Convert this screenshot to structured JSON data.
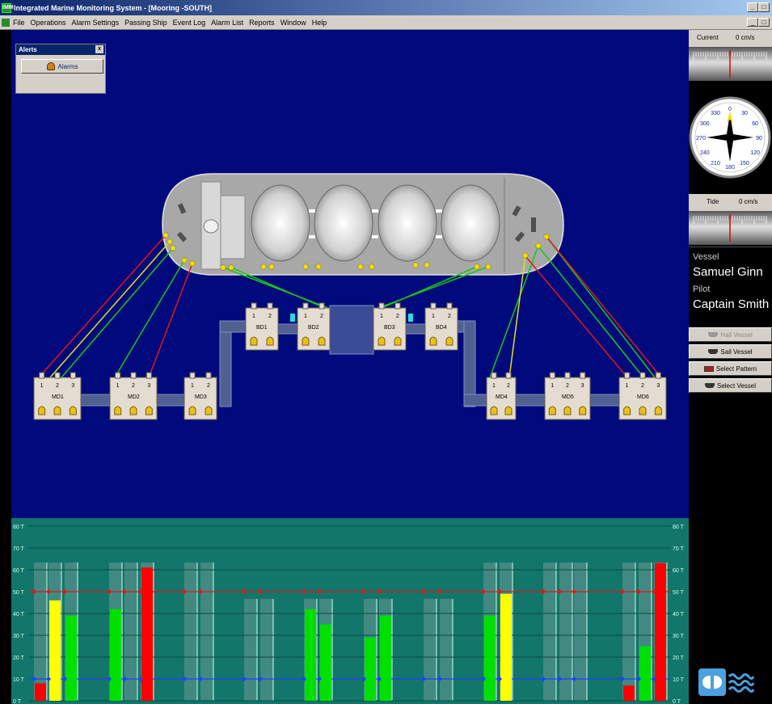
{
  "window": {
    "title": "Integrated Marine Monitoring System - [Mooring -SOUTH]",
    "app_icon": "IMM",
    "minimize": "_",
    "maximize": "□",
    "close": "x"
  },
  "menu": {
    "icon": "IMM",
    "items": [
      "File",
      "Operations",
      "Alarm Settings",
      "Passing Ship",
      "Event Log",
      "Alarm List",
      "Reports",
      "Window",
      "Help"
    ]
  },
  "alerts": {
    "title": "Alerts",
    "close": "x",
    "alarm_button": "Alarms"
  },
  "right_panel": {
    "current_label": "Current",
    "current_value": "0 cm/s",
    "tide_label": "Tide",
    "tide_value": "0 cm/s",
    "compass_labels": [
      "30",
      "60",
      "90",
      "120",
      "150",
      "180",
      "210",
      "240",
      "270",
      "300",
      "330",
      "0"
    ],
    "vessel_label": "Vessel",
    "vessel_name": "Samuel Ginn",
    "pilot_label": "Pilot",
    "pilot_name": "Captain Smith",
    "buttons": [
      "Hail Vessel",
      "Sail Vessel",
      "Select Pattern",
      "Select Vessel"
    ],
    "disabled_button": "Hail Vessel"
  },
  "hooks": {
    "MD1": {
      "label": "MD1",
      "hooks": [
        "1",
        "2",
        "3"
      ]
    },
    "MD2": {
      "label": "MD2",
      "hooks": [
        "1",
        "2",
        "3"
      ]
    },
    "MD3": {
      "label": "MD3",
      "hooks": [
        "1",
        "2"
      ]
    },
    "BD1": {
      "label": "BD1",
      "hooks": [
        "1",
        "2"
      ]
    },
    "BD2": {
      "label": "BD2",
      "hooks": [
        "1",
        "2"
      ]
    },
    "BD3": {
      "label": "BD3",
      "hooks": [
        "1",
        "2"
      ]
    },
    "BD4": {
      "label": "BD4",
      "hooks": [
        "1",
        "2"
      ]
    },
    "MD4": {
      "label": "MD4",
      "hooks": [
        "1",
        "2"
      ]
    },
    "MD5": {
      "label": "MD5",
      "hooks": [
        "1",
        "2",
        "3"
      ]
    },
    "MD6": {
      "label": "MD6",
      "hooks": [
        "1",
        "2",
        "3"
      ]
    }
  },
  "colors": {
    "sea": "#000a7c",
    "chart_bg": "#12766a",
    "line_red": "#e01818",
    "line_green": "#18c818",
    "line_yellow": "#e0e020",
    "bar_red": "#ff0000",
    "bar_green": "#00e000",
    "bar_yellow": "#ffff00",
    "threshold": "#e01818",
    "baseline": "#2040ff"
  },
  "chart_data": {
    "type": "bar",
    "y_unit": "T",
    "ylim": [
      0,
      80
    ],
    "yticks": [
      "0 T",
      "10 T",
      "20 T",
      "30 T",
      "40 T",
      "50 T",
      "60 T",
      "70 T",
      "80 T"
    ],
    "threshold": 50,
    "baseline": 10,
    "bars": [
      {
        "dolphin": "MD1",
        "line": 1,
        "value": 8,
        "color": "red"
      },
      {
        "dolphin": "MD1",
        "line": 2,
        "value": 46,
        "color": "yellow"
      },
      {
        "dolphin": "MD1",
        "line": 3,
        "value": 39,
        "color": "green"
      },
      {
        "dolphin": "MD2",
        "line": 1,
        "value": 42,
        "color": "green"
      },
      {
        "dolphin": "MD2",
        "line": 2,
        "value": 0,
        "color": "green"
      },
      {
        "dolphin": "MD2",
        "line": 3,
        "value": 61,
        "color": "red"
      },
      {
        "dolphin": "MD3",
        "line": 1,
        "value": 0,
        "color": "green"
      },
      {
        "dolphin": "MD3",
        "line": 2,
        "value": 0,
        "color": "green"
      },
      {
        "dolphin": "BD1",
        "line": 1,
        "value": 0,
        "color": "green"
      },
      {
        "dolphin": "BD1",
        "line": 2,
        "value": 0,
        "color": "green"
      },
      {
        "dolphin": "BD2",
        "line": 1,
        "value": 42,
        "color": "green"
      },
      {
        "dolphin": "BD2",
        "line": 2,
        "value": 35,
        "color": "green"
      },
      {
        "dolphin": "BD3",
        "line": 1,
        "value": 29,
        "color": "green"
      },
      {
        "dolphin": "BD3",
        "line": 2,
        "value": 39,
        "color": "green"
      },
      {
        "dolphin": "BD4",
        "line": 1,
        "value": 0,
        "color": "green"
      },
      {
        "dolphin": "BD4",
        "line": 2,
        "value": 0,
        "color": "green"
      },
      {
        "dolphin": "MD4",
        "line": 1,
        "value": 39,
        "color": "green"
      },
      {
        "dolphin": "MD4",
        "line": 2,
        "value": 49,
        "color": "yellow"
      },
      {
        "dolphin": "MD5",
        "line": 1,
        "value": 0,
        "color": "green"
      },
      {
        "dolphin": "MD5",
        "line": 2,
        "value": 0,
        "color": "green"
      },
      {
        "dolphin": "MD5",
        "line": 3,
        "value": 0,
        "color": "green"
      },
      {
        "dolphin": "MD6",
        "line": 1,
        "value": 7,
        "color": "red"
      },
      {
        "dolphin": "MD6",
        "line": 2,
        "value": 25,
        "color": "green"
      },
      {
        "dolphin": "MD6",
        "line": 3,
        "value": 63,
        "color": "red"
      }
    ]
  }
}
